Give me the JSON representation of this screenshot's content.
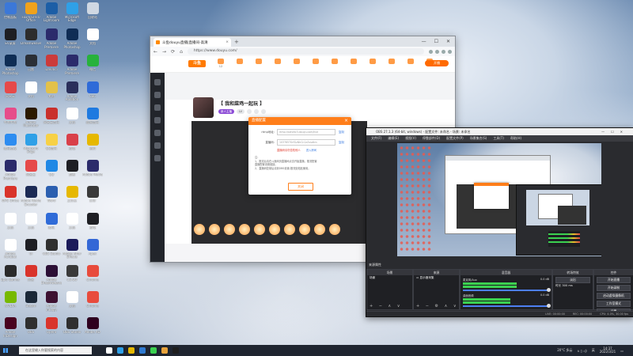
{
  "desktop": {
    "icons": [
      {
        "label": "控制面板",
        "color": "#3b78d8"
      },
      {
        "label": "Foxmail 9.0 Office",
        "color": "#f0a21b"
      },
      {
        "label": "Adobe Lightroom",
        "color": "#1c5ea6"
      },
      {
        "label": "Microsoft Edge",
        "color": "#2fa0e7"
      },
      {
        "label": "回收站",
        "color": "#cfd8e3"
      },
      {
        "label": "EV录屏",
        "color": "#1e1f24"
      },
      {
        "label": "Dreamweaver",
        "color": "#2d2d2d"
      },
      {
        "label": "Adobe Premiere",
        "color": "#2b2b6b"
      },
      {
        "label": "Adobe Photoshop",
        "color": "#0f2d55"
      },
      {
        "label": "文档",
        "color": "#ffffff"
      },
      {
        "label": "Adobe Photoshop",
        "color": "#0f2d55"
      },
      {
        "label": "迅雷",
        "color": "#2b2f36"
      },
      {
        "label": "DaVinci",
        "color": "#cc3b3b"
      },
      {
        "label": "Adobe Premiere",
        "color": "#2b2b6b"
      },
      {
        "label": "微信",
        "color": "#27b23c"
      },
      {
        "label": "网易云",
        "color": "#e64a4a"
      },
      {
        "label": "文档",
        "color": "#ffffff"
      },
      {
        "label": "素材",
        "color": "#e3c14a"
      },
      {
        "label": "Adobe Audition",
        "color": "#2a2f5a"
      },
      {
        "label": "CSC",
        "color": "#2f6bd8"
      },
      {
        "label": "哔哩哔哩",
        "color": "#e64d8a"
      },
      {
        "label": "Adobe Illustrator",
        "color": "#2b1a00"
      },
      {
        "label": "网易云音乐",
        "color": "#c9302c"
      },
      {
        "label": "文档",
        "color": "#ffffff"
      },
      {
        "label": "酷狗音乐",
        "color": "#1f7ae0"
      },
      {
        "label": "腾讯会议",
        "color": "#2d8cf0"
      },
      {
        "label": "Microsoft Edge",
        "color": "#2fa0e7"
      },
      {
        "label": "QQ音乐",
        "color": "#f7d146"
      },
      {
        "label": "游戏",
        "color": "#d9404a"
      },
      {
        "label": "资料",
        "color": "#e6b800"
      },
      {
        "label": "Adobe Premiere",
        "color": "#2b2b6b"
      },
      {
        "label": "网易云",
        "color": "#e64a4a"
      },
      {
        "label": "QQ",
        "color": "#1f88e5"
      },
      {
        "label": "剪映",
        "color": "#1e1f24"
      },
      {
        "label": "Adobe Media",
        "color": "#2b2b6b"
      },
      {
        "label": "WPS Office",
        "color": "#d9342b"
      },
      {
        "label": "Adobe Media Encoder",
        "color": "#1b2a55"
      },
      {
        "label": "Word",
        "color": "#2b5fb0"
      },
      {
        "label": "文件夹",
        "color": "#e6b800"
      },
      {
        "label": "打印",
        "color": "#3a3a3a"
      },
      {
        "label": "文档",
        "color": "#ffffff"
      },
      {
        "label": "文档",
        "color": "#ffffff"
      },
      {
        "label": "腾讯",
        "color": "#2f6bd8"
      },
      {
        "label": "文档",
        "color": "#ffffff"
      },
      {
        "label": "游戏",
        "color": "#1e1f24"
      },
      {
        "label": "Adobe Acrobat",
        "color": "#ffffff"
      },
      {
        "label": "UI",
        "color": "#1e1f24"
      },
      {
        "label": "OBS Studio",
        "color": "#2f2f2f"
      },
      {
        "label": "Adobe After Effects",
        "color": "#1b1b5a"
      },
      {
        "label": "Apex",
        "color": "#3367d6"
      },
      {
        "label": "Epic Games",
        "color": "#2a2a2a"
      },
      {
        "label": "网易",
        "color": "#d9342b"
      },
      {
        "label": "Adobe Dreamweaver",
        "color": "#2b0f35"
      },
      {
        "label": "CS:GO",
        "color": "#3a3a3a"
      },
      {
        "label": "Chrome",
        "color": "#e84b3c"
      },
      {
        "label": "NVIDIA",
        "color": "#77b900"
      },
      {
        "label": "Steam",
        "color": "#1b2838"
      },
      {
        "label": "Adobe InCopy",
        "color": "#3d1131"
      },
      {
        "label": "文档",
        "color": "#ffffff"
      },
      {
        "label": "Chrome",
        "color": "#e84b3c"
      },
      {
        "label": "Adobe InDesign",
        "color": "#49021f"
      },
      {
        "label": "OBS",
        "color": "#2f2f2f"
      },
      {
        "label": "Opera",
        "color": "#d9342b"
      },
      {
        "label": "OBS Studio",
        "color": "#2f2f2f"
      },
      {
        "label": "Adobe XD",
        "color": "#2e001f"
      }
    ]
  },
  "browser": {
    "tab_title": "斗鱼douyu直播|直播间-高清",
    "tab_close": "×",
    "new_tab": "+",
    "url": "https://www.douyu.com/",
    "window_controls": {
      "min": "—",
      "max": "☐",
      "close": "✕"
    },
    "nav": {
      "back": "←",
      "forward": "→",
      "reload": "⟳",
      "home": "⌂"
    },
    "logo": "斗鱼",
    "site_nav": [
      "12",
      "",
      "",
      "",
      "",
      "",
      "",
      "",
      "",
      "",
      "",
      ""
    ],
    "open_live": "开播"
  },
  "room": {
    "title": "【 我和菜鸡一起玩 】",
    "tags": [
      "新人主播",
      "LV",
      "",
      "",
      ""
    ],
    "rank_tabs": [
      "贡献周榜",
      "粉丝团",
      "贵宾"
    ]
  },
  "modal": {
    "title": "直播配置",
    "close": "×",
    "rows": [
      {
        "key": "rtmp地址:",
        "value": "rtmp://sendtc3.douyu.com/live",
        "action": "复制"
      },
      {
        "key": "直播码:",
        "value": "10376570rfGzNhCn1a3xvdtm",
        "action": "复制"
      }
    ],
    "red_note": "直播码请勿告知他人",
    "link_note": "进入房间",
    "notes": [
      "注：",
      "1、推流后请在斗鱼网页直播间点击开始直播，推流配置",
      "直播配置设置链接。",
      "2、直播码复制后请到OBS设置-推流处粘贴使用。"
    ],
    "button": "关闭"
  },
  "obs": {
    "title": "OBS 27.1.3 (64-bit, windows) - 配置文件: 未命名 - 场景: 未命名",
    "menus": [
      "文件(F)",
      "编辑(E)",
      "视图(V)",
      "停靠部件(D)",
      "配置文件(P)",
      "场景集合(S)",
      "工具(T)",
      "帮助(H)"
    ],
    "docks": {
      "scenes": {
        "title": "场景",
        "items": [
          "场景"
        ]
      },
      "sources": {
        "title": "来源",
        "items": [
          "显示器采集"
        ]
      },
      "mixer": {
        "title": "混音器",
        "tracks": [
          {
            "name": "麦克风/Aux",
            "db": "0.0 dB",
            "level": 0.62
          },
          {
            "name": "桌面音频",
            "db": "0.0 dB",
            "level": 0.55
          }
        ]
      },
      "transitions": {
        "title": "转场特效",
        "value": "淡出",
        "duration_label": "时长",
        "duration": "300 ms"
      },
      "controls": {
        "title": "控件",
        "buttons": [
          "开始直播",
          "开始录制",
          "启动虚拟摄像机",
          "工作室模式",
          "设置",
          "退出"
        ]
      }
    },
    "dock_label": "来源属性",
    "status": [
      "LIVE: 00:00:00",
      "REC: 00:00:00",
      "CPU: 4.0%, 30.00 fps"
    ]
  },
  "taskbar": {
    "search_placeholder": "在这里输入你要搜索的内容",
    "apps": [
      "#ffffff",
      "#2fa0e7",
      "#e6b800",
      "#2f7ad1",
      "#3bd150",
      "#e8a33c",
      "#1e1e1e"
    ],
    "weather": "20°C 多云",
    "ime": "英",
    "time": "14:37",
    "date": "2022/3/21"
  }
}
